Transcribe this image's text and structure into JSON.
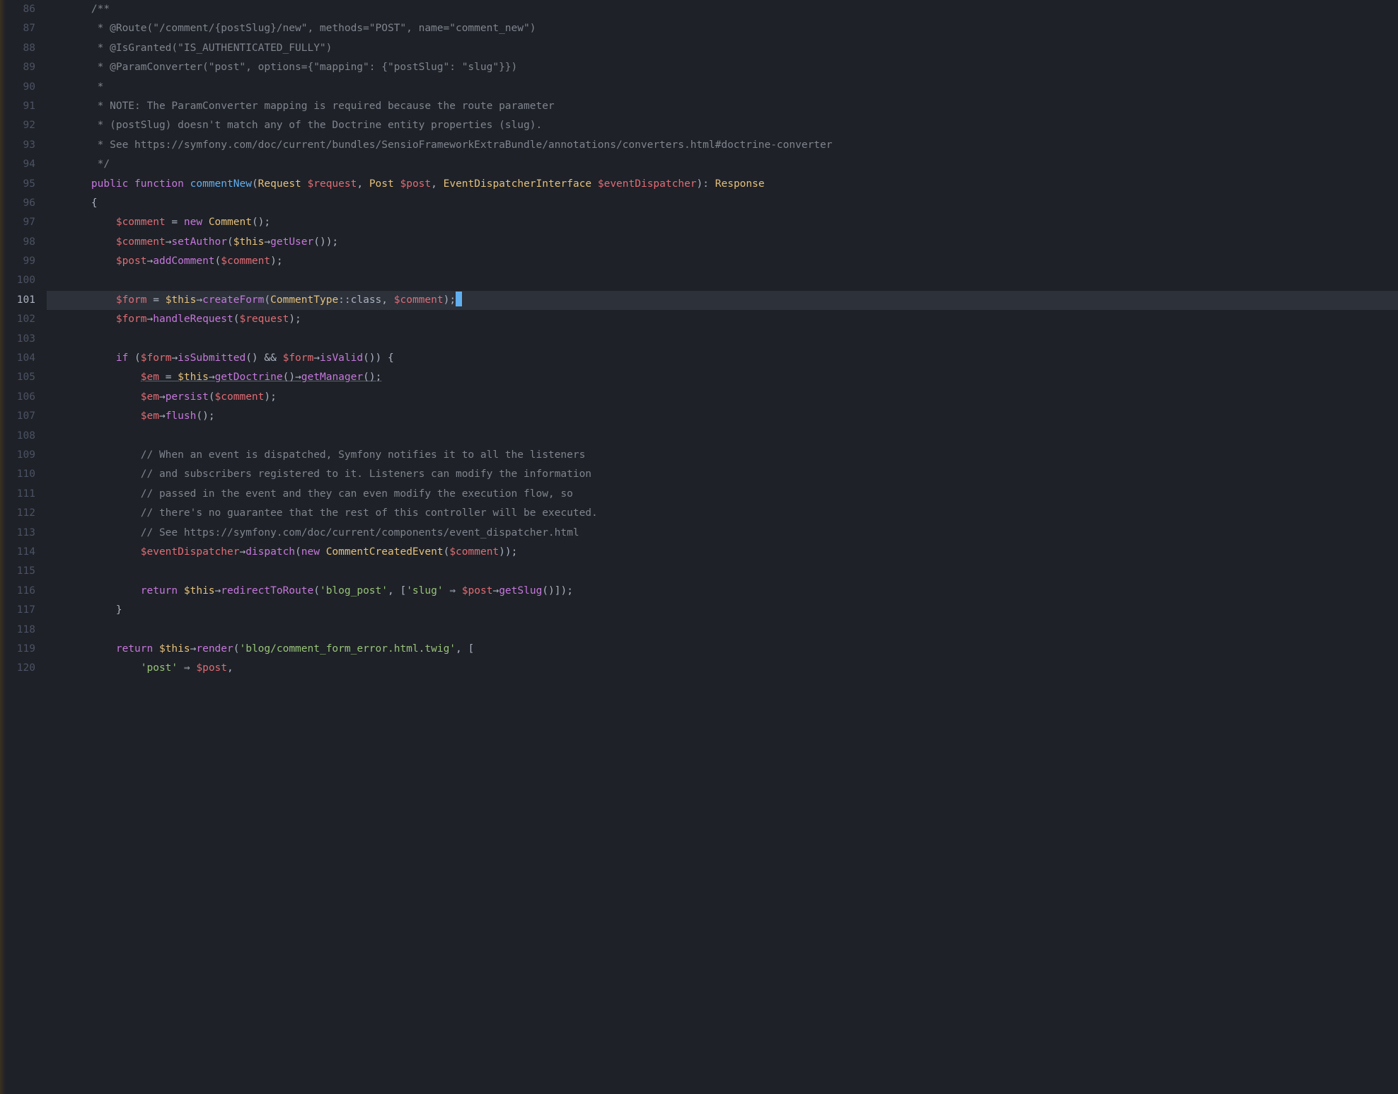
{
  "gutter": {
    "start": 86,
    "end": 120,
    "current": 101
  },
  "lines": [
    {
      "n": 86,
      "content": [
        {
          "cls": "c-comment",
          "txt": "    /**"
        }
      ]
    },
    {
      "n": 87,
      "content": [
        {
          "cls": "c-comment",
          "txt": "     * @Route(\"/comment/{postSlug}/new\", methods=\"POST\", name=\"comment_new\")"
        }
      ]
    },
    {
      "n": 88,
      "content": [
        {
          "cls": "c-comment",
          "txt": "     * @IsGranted(\"IS_AUTHENTICATED_FULLY\")"
        }
      ]
    },
    {
      "n": 89,
      "content": [
        {
          "cls": "c-comment",
          "txt": "     * @ParamConverter(\"post\", options={\"mapping\": {\"postSlug\": \"slug\"}})"
        }
      ]
    },
    {
      "n": 90,
      "content": [
        {
          "cls": "c-comment",
          "txt": "     *"
        }
      ]
    },
    {
      "n": 91,
      "content": [
        {
          "cls": "c-comment",
          "txt": "     * NOTE: The ParamConverter mapping is required because the route parameter"
        }
      ]
    },
    {
      "n": 92,
      "content": [
        {
          "cls": "c-comment",
          "txt": "     * (postSlug) doesn't match any of the Doctrine entity properties (slug)."
        }
      ]
    },
    {
      "n": 93,
      "content": [
        {
          "cls": "c-comment",
          "txt": "     * See https://symfony.com/doc/current/bundles/SensioFrameworkExtraBundle/annotations/converters.html#doctrine-converter"
        }
      ]
    },
    {
      "n": 94,
      "content": [
        {
          "cls": "c-comment",
          "txt": "     */"
        }
      ]
    },
    {
      "n": 95,
      "content": [
        {
          "cls": "c-white",
          "txt": "    "
        },
        {
          "cls": "c-keyword",
          "txt": "public"
        },
        {
          "cls": "c-white",
          "txt": " "
        },
        {
          "cls": "c-keyword",
          "txt": "function"
        },
        {
          "cls": "c-white",
          "txt": " "
        },
        {
          "cls": "c-funcname",
          "txt": "commentNew"
        },
        {
          "cls": "c-white",
          "txt": "("
        },
        {
          "cls": "c-classref",
          "txt": "Request"
        },
        {
          "cls": "c-white",
          "txt": " "
        },
        {
          "cls": "c-var",
          "txt": "$request"
        },
        {
          "cls": "c-white",
          "txt": ", "
        },
        {
          "cls": "c-classref",
          "txt": "Post"
        },
        {
          "cls": "c-white",
          "txt": " "
        },
        {
          "cls": "c-var",
          "txt": "$post"
        },
        {
          "cls": "c-white",
          "txt": ", "
        },
        {
          "cls": "c-classref",
          "txt": "EventDispatcherInterface"
        },
        {
          "cls": "c-white",
          "txt": " "
        },
        {
          "cls": "c-var",
          "txt": "$eventDispatcher"
        },
        {
          "cls": "c-white",
          "txt": "): "
        },
        {
          "cls": "c-classref",
          "txt": "Response"
        }
      ]
    },
    {
      "n": 96,
      "content": [
        {
          "cls": "c-white",
          "txt": "    {"
        }
      ]
    },
    {
      "n": 97,
      "content": [
        {
          "cls": "c-white",
          "txt": "        "
        },
        {
          "cls": "c-var",
          "txt": "$comment"
        },
        {
          "cls": "c-white",
          "txt": " = "
        },
        {
          "cls": "c-new",
          "txt": "new"
        },
        {
          "cls": "c-white",
          "txt": " "
        },
        {
          "cls": "c-classref",
          "txt": "Comment"
        },
        {
          "cls": "c-white",
          "txt": "();"
        }
      ]
    },
    {
      "n": 98,
      "content": [
        {
          "cls": "c-white",
          "txt": "        "
        },
        {
          "cls": "c-var",
          "txt": "$comment"
        },
        {
          "cls": "c-arrow",
          "txt": "→"
        },
        {
          "cls": "c-method",
          "txt": "setAuthor"
        },
        {
          "cls": "c-white",
          "txt": "("
        },
        {
          "cls": "c-this",
          "txt": "$this"
        },
        {
          "cls": "c-arrow",
          "txt": "→"
        },
        {
          "cls": "c-method",
          "txt": "getUser"
        },
        {
          "cls": "c-white",
          "txt": "());"
        }
      ]
    },
    {
      "n": 99,
      "content": [
        {
          "cls": "c-white",
          "txt": "        "
        },
        {
          "cls": "c-var",
          "txt": "$post"
        },
        {
          "cls": "c-arrow",
          "txt": "→"
        },
        {
          "cls": "c-method",
          "txt": "addComment"
        },
        {
          "cls": "c-white",
          "txt": "("
        },
        {
          "cls": "c-var",
          "txt": "$comment"
        },
        {
          "cls": "c-white",
          "txt": ");"
        }
      ]
    },
    {
      "n": 100,
      "content": []
    },
    {
      "n": 101,
      "cursor": true,
      "content": [
        {
          "cls": "c-white",
          "txt": "        "
        },
        {
          "cls": "c-var",
          "txt": "$form"
        },
        {
          "cls": "c-white",
          "txt": " = "
        },
        {
          "cls": "c-this",
          "txt": "$this"
        },
        {
          "cls": "c-arrow",
          "txt": "→"
        },
        {
          "cls": "c-method",
          "txt": "createForm"
        },
        {
          "cls": "c-white",
          "txt": "("
        },
        {
          "cls": "c-classref",
          "txt": "CommentType"
        },
        {
          "cls": "c-dblcolon",
          "txt": "::"
        },
        {
          "cls": "c-white",
          "txt": "class, "
        },
        {
          "cls": "c-var",
          "txt": "$comment"
        },
        {
          "cls": "c-white",
          "txt": ");"
        }
      ]
    },
    {
      "n": 102,
      "content": [
        {
          "cls": "c-white",
          "txt": "        "
        },
        {
          "cls": "c-var",
          "txt": "$form"
        },
        {
          "cls": "c-arrow",
          "txt": "→"
        },
        {
          "cls": "c-method",
          "txt": "handleRequest"
        },
        {
          "cls": "c-white",
          "txt": "("
        },
        {
          "cls": "c-var",
          "txt": "$request"
        },
        {
          "cls": "c-white",
          "txt": ");"
        }
      ]
    },
    {
      "n": 103,
      "content": []
    },
    {
      "n": 104,
      "content": [
        {
          "cls": "c-white",
          "txt": "        "
        },
        {
          "cls": "c-keyword",
          "txt": "if"
        },
        {
          "cls": "c-white",
          "txt": " ("
        },
        {
          "cls": "c-var",
          "txt": "$form"
        },
        {
          "cls": "c-arrow",
          "txt": "→"
        },
        {
          "cls": "c-method",
          "txt": "isSubmitted"
        },
        {
          "cls": "c-white",
          "txt": "() && "
        },
        {
          "cls": "c-var",
          "txt": "$form"
        },
        {
          "cls": "c-arrow",
          "txt": "→"
        },
        {
          "cls": "c-method",
          "txt": "isValid"
        },
        {
          "cls": "c-white",
          "txt": "()) {"
        }
      ]
    },
    {
      "n": 105,
      "content": [
        {
          "cls": "c-white",
          "txt": "            "
        },
        {
          "cls": "c-var c-underline",
          "txt": "$em"
        },
        {
          "cls": "c-white c-underline",
          "txt": " = "
        },
        {
          "cls": "c-this c-underline",
          "txt": "$this"
        },
        {
          "cls": "c-arrow c-underline",
          "txt": "→"
        },
        {
          "cls": "c-method c-underline",
          "txt": "getDoctrine"
        },
        {
          "cls": "c-white c-underline",
          "txt": "()"
        },
        {
          "cls": "c-arrow c-underline",
          "txt": "→"
        },
        {
          "cls": "c-method c-underline",
          "txt": "getManager"
        },
        {
          "cls": "c-white c-underline",
          "txt": "();"
        }
      ]
    },
    {
      "n": 106,
      "content": [
        {
          "cls": "c-white",
          "txt": "            "
        },
        {
          "cls": "c-var",
          "txt": "$em"
        },
        {
          "cls": "c-arrow",
          "txt": "→"
        },
        {
          "cls": "c-method",
          "txt": "persist"
        },
        {
          "cls": "c-white",
          "txt": "("
        },
        {
          "cls": "c-var",
          "txt": "$comment"
        },
        {
          "cls": "c-white",
          "txt": ");"
        }
      ]
    },
    {
      "n": 107,
      "content": [
        {
          "cls": "c-white",
          "txt": "            "
        },
        {
          "cls": "c-var",
          "txt": "$em"
        },
        {
          "cls": "c-arrow",
          "txt": "→"
        },
        {
          "cls": "c-method",
          "txt": "flush"
        },
        {
          "cls": "c-white",
          "txt": "();"
        }
      ]
    },
    {
      "n": 108,
      "content": []
    },
    {
      "n": 109,
      "content": [
        {
          "cls": "c-comment",
          "txt": "            // When an event is dispatched, Symfony notifies it to all the listeners"
        }
      ]
    },
    {
      "n": 110,
      "content": [
        {
          "cls": "c-comment",
          "txt": "            // and subscribers registered to it. Listeners can modify the information"
        }
      ]
    },
    {
      "n": 111,
      "content": [
        {
          "cls": "c-comment",
          "txt": "            // passed in the event and they can even modify the execution flow, so"
        }
      ]
    },
    {
      "n": 112,
      "content": [
        {
          "cls": "c-comment",
          "txt": "            // there's no guarantee that the rest of this controller will be executed."
        }
      ]
    },
    {
      "n": 113,
      "content": [
        {
          "cls": "c-comment",
          "txt": "            // See https://symfony.com/doc/current/components/event_dispatcher.html"
        }
      ]
    },
    {
      "n": 114,
      "content": [
        {
          "cls": "c-white",
          "txt": "            "
        },
        {
          "cls": "c-var",
          "txt": "$eventDispatcher"
        },
        {
          "cls": "c-arrow",
          "txt": "→"
        },
        {
          "cls": "c-method",
          "txt": "dispatch"
        },
        {
          "cls": "c-white",
          "txt": "("
        },
        {
          "cls": "c-new",
          "txt": "new"
        },
        {
          "cls": "c-white",
          "txt": " "
        },
        {
          "cls": "c-classref",
          "txt": "CommentCreatedEvent"
        },
        {
          "cls": "c-white",
          "txt": "("
        },
        {
          "cls": "c-var",
          "txt": "$comment"
        },
        {
          "cls": "c-white",
          "txt": "));"
        }
      ]
    },
    {
      "n": 115,
      "content": []
    },
    {
      "n": 116,
      "content": [
        {
          "cls": "c-white",
          "txt": "            "
        },
        {
          "cls": "c-return",
          "txt": "return"
        },
        {
          "cls": "c-white",
          "txt": " "
        },
        {
          "cls": "c-this",
          "txt": "$this"
        },
        {
          "cls": "c-arrow",
          "txt": "→"
        },
        {
          "cls": "c-method",
          "txt": "redirectToRoute"
        },
        {
          "cls": "c-white",
          "txt": "("
        },
        {
          "cls": "c-string2",
          "txt": "'blog_post'"
        },
        {
          "cls": "c-white",
          "txt": ", ["
        },
        {
          "cls": "c-string2",
          "txt": "'slug'"
        },
        {
          "cls": "c-white",
          "txt": " ⇒ "
        },
        {
          "cls": "c-var",
          "txt": "$post"
        },
        {
          "cls": "c-arrow",
          "txt": "→"
        },
        {
          "cls": "c-method",
          "txt": "getSlug"
        },
        {
          "cls": "c-white",
          "txt": "()]);"
        }
      ]
    },
    {
      "n": 117,
      "content": [
        {
          "cls": "c-white",
          "txt": "        }"
        }
      ]
    },
    {
      "n": 118,
      "content": []
    },
    {
      "n": 119,
      "content": [
        {
          "cls": "c-white",
          "txt": "        "
        },
        {
          "cls": "c-return",
          "txt": "return"
        },
        {
          "cls": "c-white",
          "txt": " "
        },
        {
          "cls": "c-this",
          "txt": "$this"
        },
        {
          "cls": "c-arrow",
          "txt": "→"
        },
        {
          "cls": "c-method",
          "txt": "render"
        },
        {
          "cls": "c-white",
          "txt": "("
        },
        {
          "cls": "c-string2",
          "txt": "'blog/comment_form_error.html.twig'"
        },
        {
          "cls": "c-white",
          "txt": ", ["
        }
      ]
    },
    {
      "n": 120,
      "content": [
        {
          "cls": "c-white",
          "txt": "            "
        },
        {
          "cls": "c-string2",
          "txt": "'post'"
        },
        {
          "cls": "c-white",
          "txt": " ⇒ "
        },
        {
          "cls": "c-var",
          "txt": "$post"
        },
        {
          "cls": "c-white",
          "txt": ","
        }
      ]
    }
  ]
}
